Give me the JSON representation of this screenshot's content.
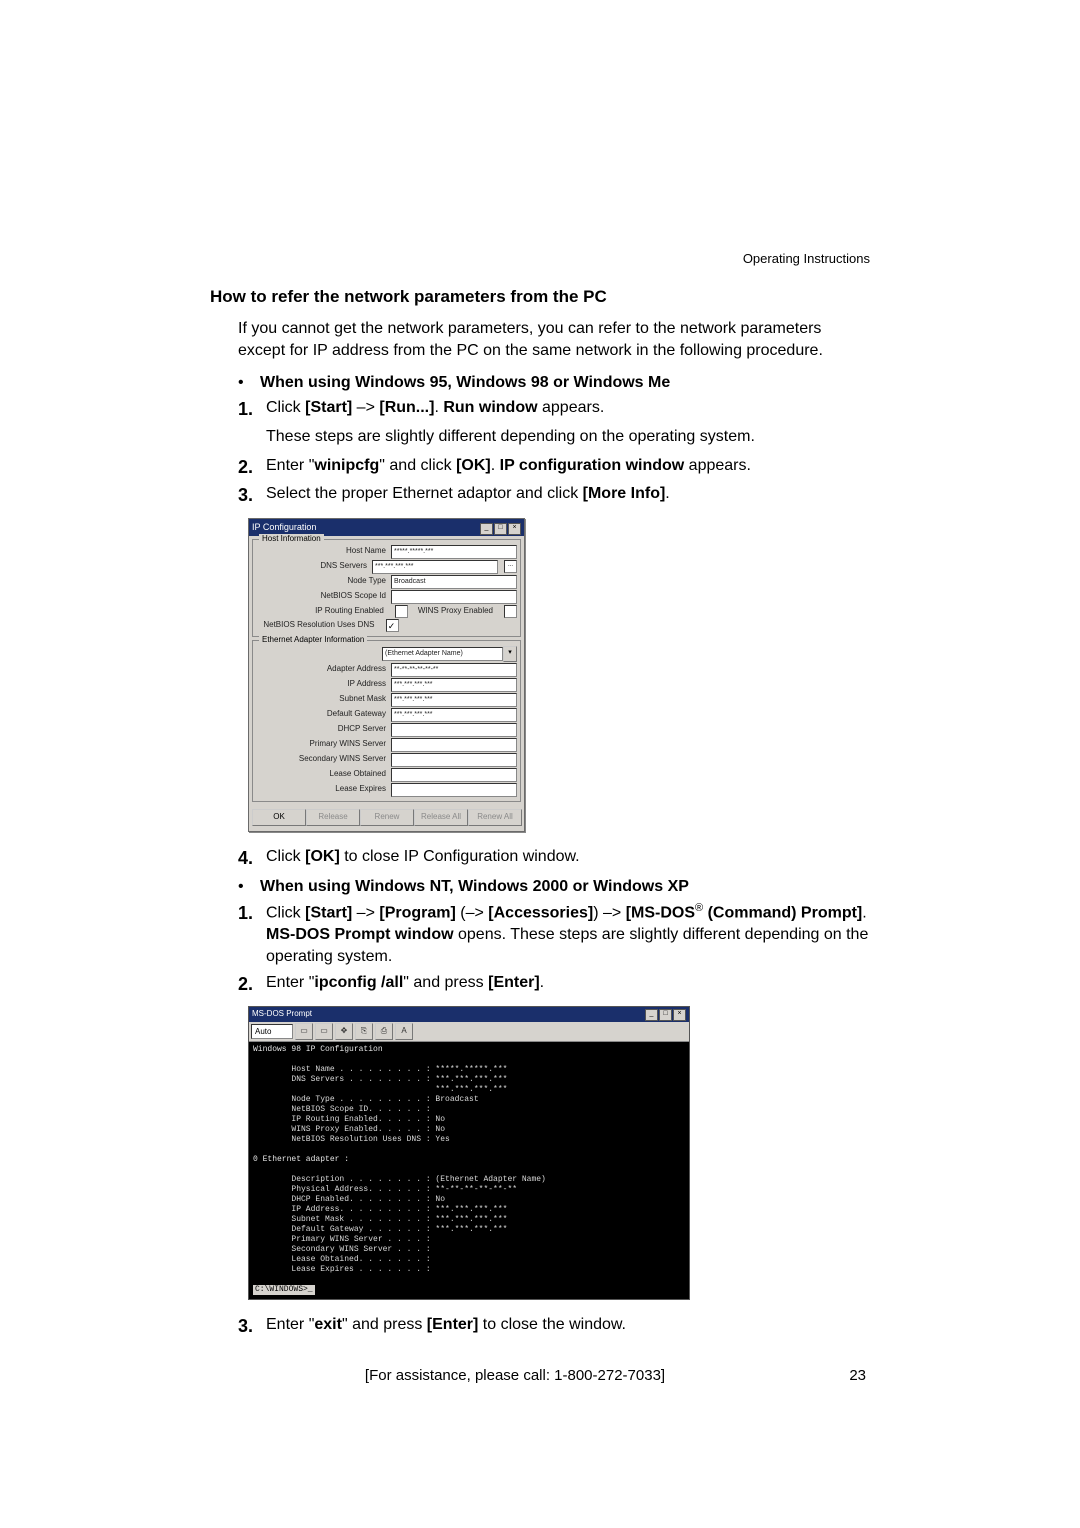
{
  "header": {
    "right": "Operating Instructions"
  },
  "title": "How to refer the network parameters from the PC",
  "intro": "If you cannot get the network parameters, you can refer to the network parameters except for IP address from the PC on the same network in the following procedure.",
  "win9x": {
    "bullet": "When using Windows 95, Windows 98 or Windows Me",
    "step1_pre": "Click ",
    "step1_b1": "[Start]",
    "step1_arrow": " –> ",
    "step1_b2": "[Run...]",
    "step1_mid": ". ",
    "step1_b3": "Run window",
    "step1_post": " appears.",
    "step1_line2": "These steps are slightly different depending on the operating system.",
    "step2_pre": "Enter \"",
    "step2_cmd": "winipcfg",
    "step2_mid": "\" and click ",
    "step2_ok": "[OK]",
    "step2_mid2": ". ",
    "step2_b": "IP configuration window",
    "step2_post": " appears.",
    "step3_pre": "Select the proper Ethernet adaptor and click ",
    "step3_b": "[More Info]",
    "step3_post": ".",
    "step4_pre": "Click ",
    "step4_b": "[OK]",
    "step4_post": " to close IP Configuration window."
  },
  "ipcfg": {
    "title": "IP Configuration",
    "group1": "Host Information",
    "host_name_l": "Host Name",
    "host_name_v": "*****.*****.***",
    "dns_l": "DNS Servers",
    "dns_v": "***.***.***.***",
    "dns_btn": "...",
    "node_l": "Node Type",
    "node_v": "Broadcast",
    "scope_l": "NetBIOS Scope Id",
    "scope_v": "",
    "iprouting_l": "IP Routing Enabled",
    "winsproxy_l": "WINS Proxy Enabled",
    "netbios_dns_l": "NetBIOS Resolution Uses DNS",
    "netbios_check": "✓",
    "group2": "Ethernet Adapter Information",
    "adapter_combo": "(Ethernet Adapter Name)",
    "addr_l": "Adapter Address",
    "addr_v": "**-**-**-**-**-**",
    "ip_l": "IP Address",
    "ip_v": "***.***.***.***",
    "subnet_l": "Subnet Mask",
    "subnet_v": "***.***.***.***",
    "gw_l": "Default Gateway",
    "gw_v": "***.***.***.***",
    "dhcp_l": "DHCP Server",
    "dhcp_v": "",
    "pwins_l": "Primary WINS Server",
    "pwins_v": "",
    "swins_l": "Secondary WINS Server",
    "swins_v": "",
    "lease_obt_l": "Lease Obtained",
    "lease_obt_v": "",
    "lease_exp_l": "Lease Expires",
    "lease_exp_v": "",
    "btn_ok": "OK",
    "btn_release": "Release",
    "btn_renew": "Renew",
    "btn_release_all": "Release All",
    "btn_renew_all": "Renew All"
  },
  "winnt": {
    "bullet": "When using Windows NT, Windows 2000 or Windows XP",
    "step1_a": "Click ",
    "step1_b1": "[Start]",
    "step1_arr": " –> ",
    "step1_b2": "[Program]",
    "step1_paren_open": " (–> ",
    "step1_b3": "[Accessories]",
    "step1_paren_close": ") –> ",
    "step1_b4": "[MS-DOS",
    "step1_reg": "®",
    "step1_b5": " (Command) Prompt]",
    "step1_mid": ". ",
    "step1_b6": "MS-DOS Prompt window",
    "step1_post": " opens. These steps are slightly different depending on the operating system.",
    "step2_pre": "Enter \"",
    "step2_cmd": "ipconfig /all",
    "step2_mid": "\" and press ",
    "step2_b": "[Enter]",
    "step2_post": ".",
    "step3_pre": "Enter \"",
    "step3_cmd": "exit",
    "step3_mid": "\" and press ",
    "step3_b": "[Enter]",
    "step3_post": " to close the window."
  },
  "dos": {
    "title": "MS-DOS Prompt",
    "combo": "Auto",
    "header_line": "Windows 98 IP Configuration",
    "lines1": "        Host Name . . . . . . . . . : *****.*****.***\n        DNS Servers . . . . . . . . : ***.***.***.***\n                                      ***.***.***.***\n        Node Type . . . . . . . . . : Broadcast\n        NetBIOS Scope ID. . . . . . :\n        IP Routing Enabled. . . . . : No\n        WINS Proxy Enabled. . . . . : No\n        NetBIOS Resolution Uses DNS : Yes",
    "section2": "0 Ethernet adapter :",
    "lines2": "        Description . . . . . . . . : (Ethernet Adapter Name)\n        Physical Address. . . . . . : **-**-**-**-**-**\n        DHCP Enabled. . . . . . . . : No\n        IP Address. . . . . . . . . : ***.***.***.***\n        Subnet Mask . . . . . . . . : ***.***.***.***\n        Default Gateway . . . . . . : ***.***.***.***\n        Primary WINS Server . . . . :\n        Secondary WINS Server . . . :\n        Lease Obtained. . . . . . . :\n        Lease Expires . . . . . . . :",
    "prompt": "C:\\WINDOWS>_"
  },
  "footer": {
    "assist": "[For assistance, please call: 1-800-272-7033]",
    "page": "23"
  },
  "nums": {
    "n1": "1.",
    "n2": "2.",
    "n3": "3.",
    "n4": "4."
  },
  "bullet": "•"
}
